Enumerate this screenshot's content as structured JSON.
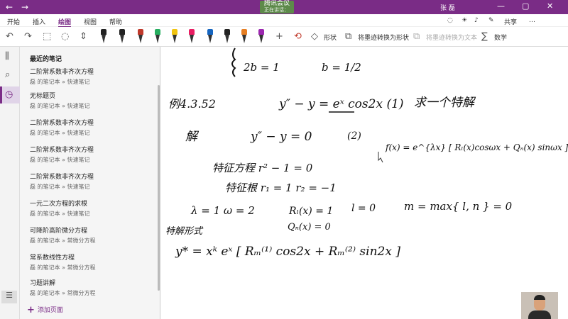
{
  "titlebar": {
    "back": "←",
    "forward": "→",
    "meeting_label": "腾讯会议",
    "meeting_sub": "正在讲话：",
    "user": "张 磊",
    "min": "—",
    "max": "▢",
    "close": "✕"
  },
  "tabs": [
    "开始",
    "插入",
    "绘图",
    "视图",
    "帮助"
  ],
  "active_tab": "绘图",
  "ribbon_right": [
    "共享",
    "…"
  ],
  "toolbar": {
    "shape_label": "形状",
    "ink_to_shape_label": "将墨迹转换为形状",
    "ink_to_text_label": "将墨迹转换为文本",
    "math_label": "数学",
    "pen_colors": [
      "#222222",
      "#222222",
      "#c0392b",
      "#27ae60",
      "#f1c40f",
      "#e91e63",
      "#1565c0",
      "#222222",
      "#e67e22",
      "#9c27b0",
      "#222222"
    ]
  },
  "panel": {
    "heading": "最近的笔记",
    "notes": [
      {
        "title": "二阶常系数非齐次方程",
        "path": "磊 的笔记本 » 快速笔记"
      },
      {
        "title": "无标题页",
        "path": "磊 的笔记本 » 快速笔记"
      },
      {
        "title": "二阶常系数非齐次方程",
        "path": "磊 的笔记本 » 快速笔记"
      },
      {
        "title": "二阶常系数非齐次方程",
        "path": "磊 的笔记本 » 快速笔记"
      },
      {
        "title": "二阶常系数非齐次方程",
        "path": "磊 的笔记本 » 快速笔记"
      },
      {
        "title": "一元二次方程的求根",
        "path": "磊 的笔记本 » 快速笔记"
      },
      {
        "title": "可降阶高阶微分方程",
        "path": "磊 的笔记本 » 常微分方程"
      },
      {
        "title": "常系数线性方程",
        "path": "磊 的笔记本 » 常微分方程"
      },
      {
        "title": "习题讲解",
        "path": "磊 的笔记本 » 常微分方程"
      }
    ],
    "add_page": "添加页面"
  },
  "ink": {
    "l1a": "2b = 1",
    "l1b": "b = 1/2",
    "example": "例4.3.52",
    "equation": "y″ − y = eˣ cos2x (1)",
    "ask": "求一个特解",
    "solve": "解",
    "homog": "y″ − y = 0",
    "homog_num": "(2)",
    "form": "f(x) = e^{λx} [ Rₗ(x)cosωx + Qₙ(x) sinωx ]",
    "char_eq": "特征方程  r² − 1 = 0",
    "char_roots": "特征根  r₁ = 1   r₂ = −1",
    "params": "λ = 1    ω = 2",
    "r_l": "Rₗ(x) = 1",
    "l_val": "l = 0",
    "m_val": "m = max{ l, n } = 0",
    "q_n": "Qₙ(x) = 0",
    "particular_label": "特解形式",
    "particular": "y* =  xᵏ eˣ [ Rₘ⁽¹⁾ cos2x  +  Rₘ⁽²⁾ sin2x ]"
  }
}
